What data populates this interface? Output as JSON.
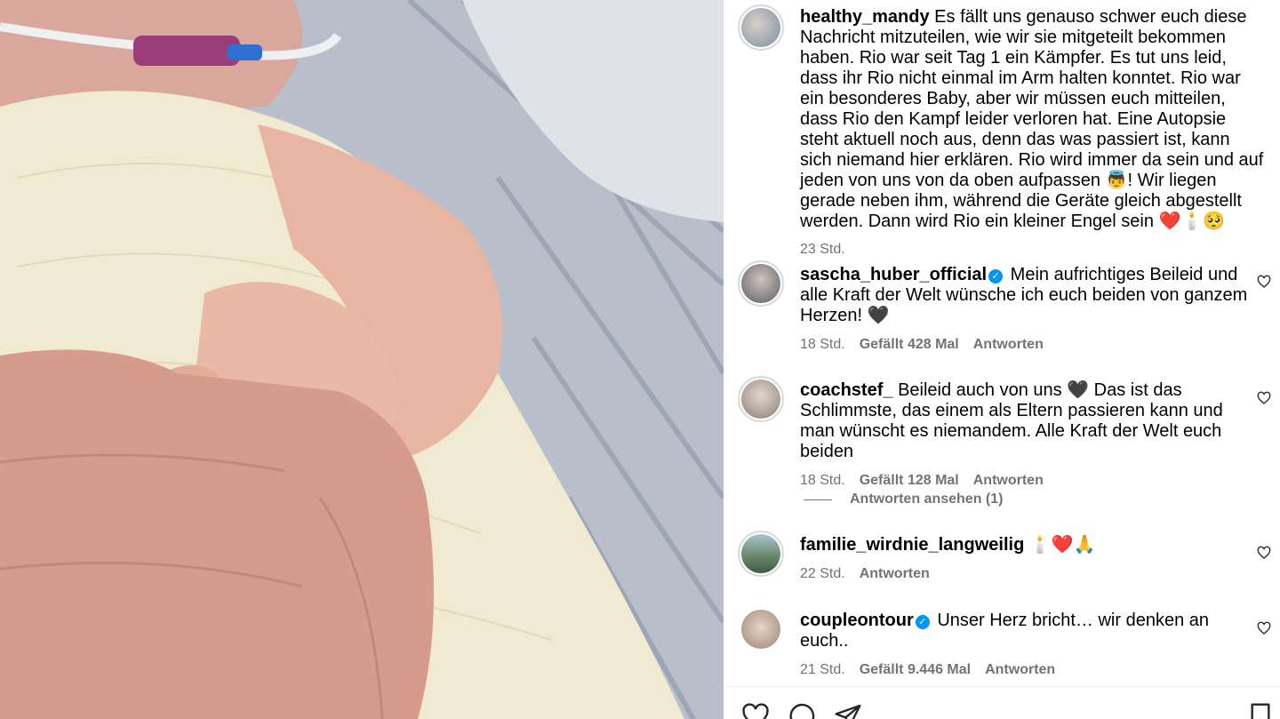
{
  "caption": {
    "username": "healthy_mandy",
    "text": "Es fällt uns genauso schwer euch diese Nachricht mitzuteilen, wie wir sie mitgeteilt bekommen haben. Rio war seit Tag 1 ein Kämpfer. Es tut uns leid, dass ihr Rio nicht einmal im Arm halten konntet. Rio war ein besonderes Baby, aber wir müssen euch mitteilen, dass Rio den Kampf leider verloren hat. Eine Autopsie steht aktuell noch aus, denn das was passiert ist, kann sich niemand hier erklären. Rio wird immer da sein und auf jeden von uns von da oben aufpassen 👼! Wir liegen gerade neben ihm, während die Geräte gleich abgestellt werden. Dann wird Rio ein kleiner Engel sein ❤️🕯️🥺",
    "time": "23 Std."
  },
  "comments": [
    {
      "username": "sascha_huber_official",
      "verified": true,
      "text": "Mein aufrichtiges Beileid und alle Kraft der Welt wünsche ich euch beiden von ganzem Herzen! 🖤",
      "time": "18 Std.",
      "likes": "Gefällt 428 Mal",
      "reply": "Antworten"
    },
    {
      "username": "coachstef_",
      "verified": false,
      "text": "Beileid auch von uns 🖤 Das ist das Schlimmste, das einem als Eltern passieren kann und man wünscht es niemandem. Alle Kraft der Welt euch beiden",
      "time": "18 Std.",
      "likes": "Gefällt 128 Mal",
      "reply": "Antworten",
      "view_replies": "Antworten ansehen (1)"
    },
    {
      "username": "familie_wirdnie_langweilig",
      "verified": false,
      "text": "🕯️❤️🙏",
      "time": "22 Std.",
      "likes": "",
      "reply": "Antworten"
    },
    {
      "username": "coupleontour",
      "verified": true,
      "text": "Unser Herz bricht… wir denken an euch..",
      "time": "21 Std.",
      "likes": "Gefällt 9.446 Mal",
      "reply": "Antworten"
    }
  ],
  "icons": {
    "like": "heart-outline-icon",
    "comment": "comment-bubble-icon",
    "share": "paper-plane-icon",
    "save": "bookmark-icon"
  },
  "colors": {
    "verified": "#0095f6",
    "meta_text": "#737373"
  }
}
